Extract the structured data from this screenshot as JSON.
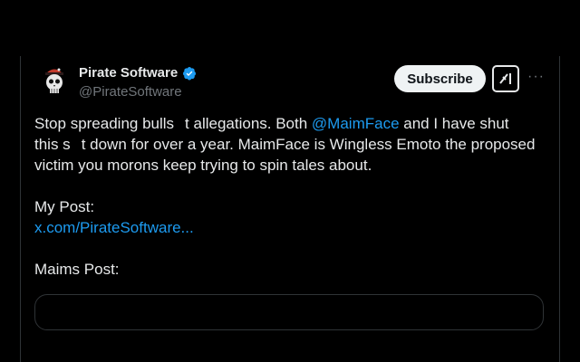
{
  "author": {
    "display_name": "Pirate Software",
    "handle": "@PirateSoftware",
    "verified": true,
    "avatar_icon": "pirate-skull-icon"
  },
  "actions": {
    "subscribe_label": "Subscribe",
    "grok_icon": "grok-icon",
    "more_icon": "more-icon",
    "more_label": "···"
  },
  "post": {
    "line1_before": "Stop spreading bulls",
    "line1_after": "t allegations. Both ",
    "mention": "@MaimFace",
    "line1_end": " and I have shut",
    "line2_before": "this s",
    "line2_after": "t down for over a year. MaimFace is Wingless Emoto the proposed",
    "line3": "victim you morons keep trying to spin tales about.",
    "my_post_label": "My Post:",
    "my_post_link": "x.com/PirateSoftware...",
    "maims_post_label": "Maims Post:"
  },
  "colors": {
    "background": "#000000",
    "text": "#e7e9ea",
    "secondary": "#71767b",
    "link": "#1d9bf0",
    "verified": "#1d9bf0",
    "border": "#2f3336"
  }
}
